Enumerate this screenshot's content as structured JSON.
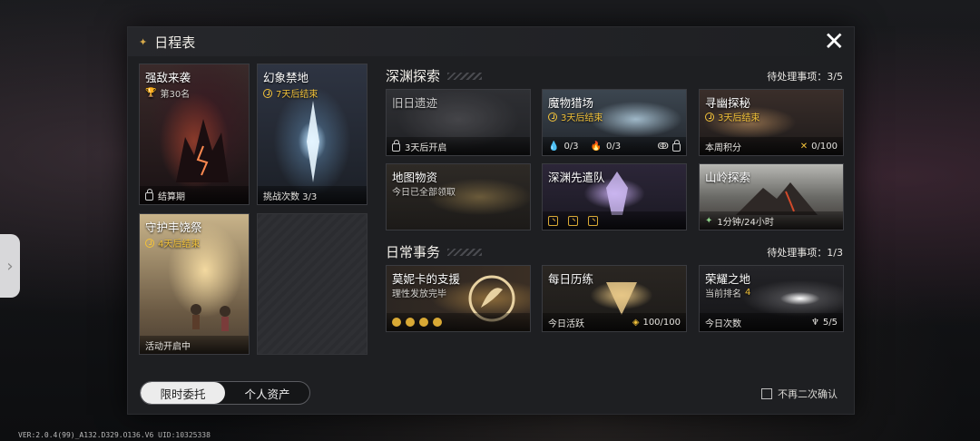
{
  "window": {
    "title": "日程表",
    "close_glyph": "✕"
  },
  "left_cards": [
    {
      "name": "强敌来袭",
      "sub": "第30名",
      "bottom": "结算期"
    },
    {
      "name": "幻象禁地",
      "sub": "7天后结束",
      "bottom": "挑战次数 3/3"
    },
    {
      "name": "守护丰饶祭",
      "sub": "4天后结束",
      "bottom": "活动开启中"
    }
  ],
  "abyss": {
    "title": "深渊探索",
    "pending_label": "待处理事项：3/5",
    "cards": [
      {
        "name": "旧日遗迹",
        "bottom": "3天后开启"
      },
      {
        "name": "魔物猎场",
        "sub": "3天后结束",
        "c1": "0/3",
        "c2": "0/3"
      },
      {
        "name": "寻幽探秘",
        "sub": "3天后结束",
        "bottom": "本周积分",
        "value": "0/100"
      },
      {
        "name": "地图物资",
        "sub": "今日已全部领取"
      },
      {
        "name": "深渊先遣队"
      },
      {
        "name": "山岭探索",
        "bottom": "1分钟/24小时"
      }
    ]
  },
  "daily": {
    "title": "日常事务",
    "pending_label": "待处理事项：1/3",
    "cards": [
      {
        "name": "莫妮卡的支援",
        "sub": "理性发放完毕"
      },
      {
        "name": "每日历练",
        "bottom": "今日活跃",
        "value": "100/100"
      },
      {
        "name": "荣耀之地",
        "sub_label": "当前排名",
        "sub_value": "4",
        "bottom": "今日次数",
        "value": "5/5"
      }
    ]
  },
  "tabs": {
    "active": "限时委托",
    "inactive": "个人资产"
  },
  "confirm_label": "不再二次确认",
  "version": "VER:2.0.4(99)_A132.D329.O136.V6   UID:10325338",
  "colors": {
    "accent_gold": "#f2c23a",
    "panel_bg": "#1e1f22"
  }
}
